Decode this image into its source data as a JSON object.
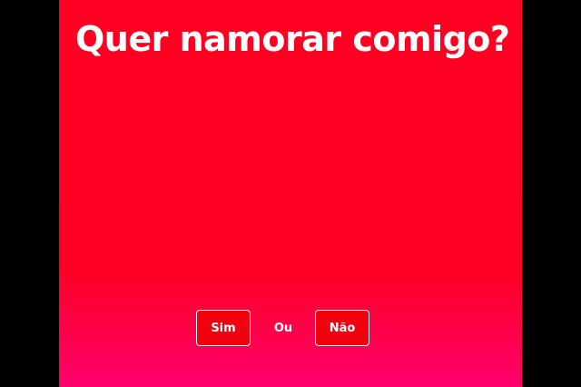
{
  "question": {
    "title": "Quer namorar comigo?"
  },
  "choices": {
    "yes_label": "Sim",
    "or_label": "Ou",
    "no_label": "Não"
  },
  "colors": {
    "background": "#000000",
    "panel_top": "#ff0022",
    "panel_bottom": "#ff006c",
    "button_fill": "#f2000e",
    "text": "#ffffff"
  }
}
